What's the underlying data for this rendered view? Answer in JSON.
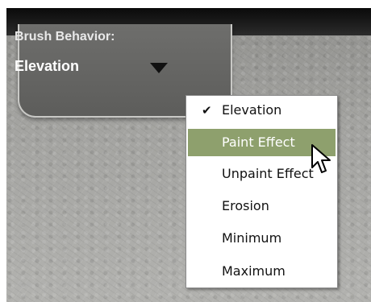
{
  "panel": {
    "label": "Brush Behavior:",
    "value": "Elevation"
  },
  "menu": {
    "items": [
      {
        "label": "Elevation",
        "checked": true,
        "highlighted": false
      },
      {
        "label": "Paint Effect",
        "checked": false,
        "highlighted": true
      },
      {
        "label": "Unpaint Effect",
        "checked": false,
        "highlighted": false
      },
      {
        "label": "Erosion",
        "checked": false,
        "highlighted": false
      },
      {
        "label": "Minimum",
        "checked": false,
        "highlighted": false
      },
      {
        "label": "Maximum",
        "checked": false,
        "highlighted": false
      }
    ],
    "highlight_color": "#8ea06d"
  },
  "icons": {
    "check": "check-icon",
    "dropdown": "dropdown-arrow-icon",
    "cursor": "mouse-pointer-icon"
  }
}
